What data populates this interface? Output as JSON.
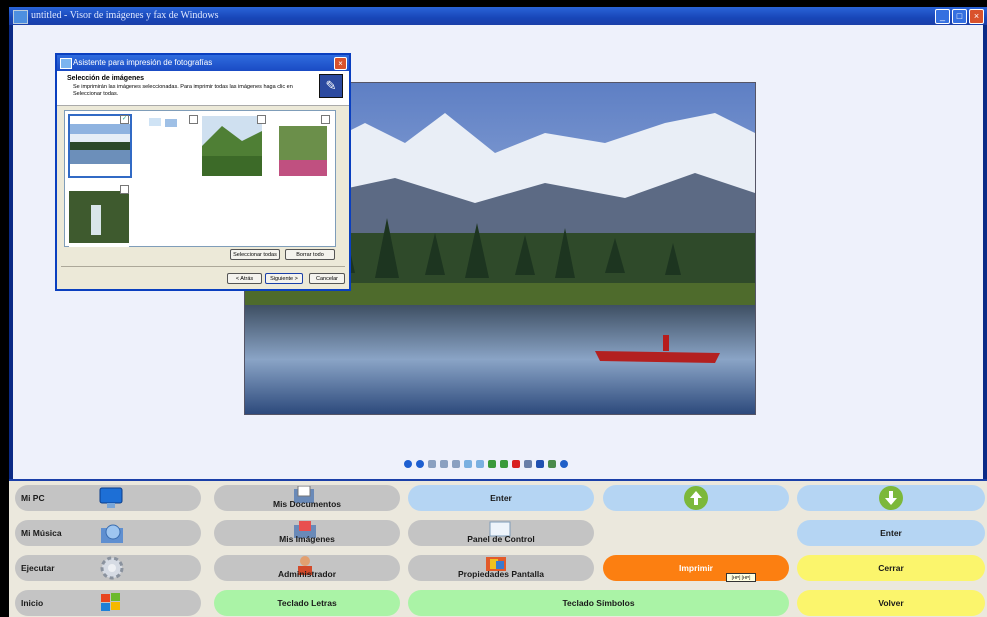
{
  "window": {
    "title": "untitled - Visor de imágenes y fax de Windows",
    "controls": [
      "minimize-icon",
      "maximize-icon",
      "close-icon"
    ]
  },
  "dialog": {
    "title": "Asistente para impresión de fotografías",
    "heading": "Selección de imágenes",
    "description": "Se imprimirán las imágenes seleccionadas. Para imprimir todas las imágenes haga clic en Seleccionar todas.",
    "select_all": "Seleccionar todas",
    "clear_all": "Borrar todo",
    "back": "< Atrás",
    "next": "Siguiente >",
    "cancel": "Cancelar",
    "thumbnails": [
      {
        "name": "lake-mountains",
        "checked": true
      },
      {
        "name": "desktop-screenshot",
        "checked": false
      },
      {
        "name": "green-hills",
        "checked": false
      },
      {
        "name": "garden",
        "checked": false
      },
      {
        "name": "waterfall",
        "checked": false
      }
    ]
  },
  "panel": {
    "mi_pc": "Mi PC",
    "mis_documentos": "Mis Documentos",
    "enter_top": "Enter",
    "mi_musica": "Mi Música",
    "mis_imagenes": "Mis Imágenes",
    "panel_control": "Panel de Control",
    "enter_right": "Enter",
    "ejecutar": "Ejecutar",
    "administrador": "Administrador",
    "propiedades": "Propiedades Pantalla",
    "imprimir": "Imprimir",
    "cerrar": "Cerrar",
    "inicio": "Inicio",
    "teclado_letras": "Teclado Letras",
    "teclado_simbolos": "Teclado Símbolos",
    "volver": "Volver",
    "tooltip": "[HP] [HP]"
  },
  "colors": {
    "gray": "#c4c4c4",
    "blue": "#b5d5f3",
    "green": "#aaf3a6",
    "yellow": "#fbf56c",
    "orange": "#fc7f11",
    "titlebar": "#1846b8"
  }
}
